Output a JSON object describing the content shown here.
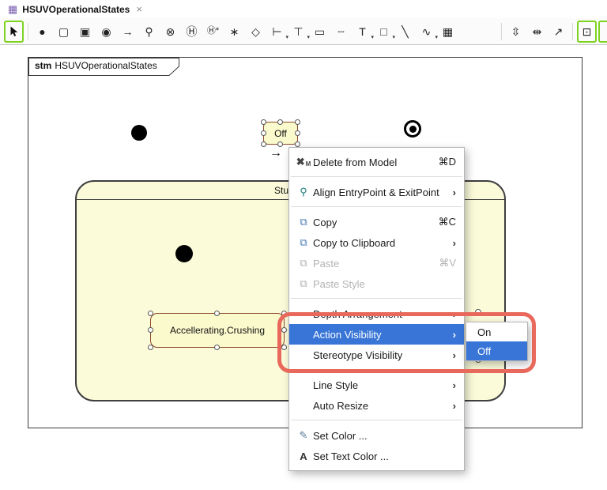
{
  "colors": {
    "selection_blue": "#3875D7",
    "annotation_red": "#E8695B",
    "state_fill": "#FBFACD",
    "state_border": "#8D4A2B",
    "tool_selected_green": "#7ED321"
  },
  "tab": {
    "icon_glyph": "▦",
    "label": "HSUVOperationalStates",
    "close": "×"
  },
  "toolbar": {
    "caret": "▾",
    "tools": [
      {
        "name": "pointer-tool",
        "glyph": ""
      },
      {
        "name": "initial-state-tool",
        "glyph": "●"
      },
      {
        "name": "state-tool",
        "glyph": "▢"
      },
      {
        "name": "submachine-state-tool",
        "glyph": "▣"
      },
      {
        "name": "final-state-tool",
        "glyph": "◉"
      },
      {
        "name": "transition-tool",
        "glyph": "→"
      },
      {
        "name": "entry-point-tool",
        "glyph": "⚲"
      },
      {
        "name": "exit-point-tool",
        "glyph": "⊗"
      },
      {
        "name": "shallow-history-tool",
        "glyph": "Ⓗ"
      },
      {
        "name": "deep-history-tool",
        "glyph": "Ⓗ*"
      },
      {
        "name": "junction-tool",
        "glyph": "∗"
      },
      {
        "name": "choice-tool",
        "glyph": "◇"
      },
      {
        "name": "fork-tool",
        "glyph": "⊢"
      },
      {
        "name": "join-tool",
        "glyph": "⊤"
      },
      {
        "name": "note-tool",
        "glyph": "▭"
      },
      {
        "name": "anchor-tool",
        "glyph": "┄"
      },
      {
        "name": "text-tool",
        "glyph": "T"
      },
      {
        "name": "rectangle-tool",
        "glyph": "□"
      },
      {
        "name": "line-tool",
        "glyph": "╲"
      },
      {
        "name": "curve-tool",
        "glyph": "∿"
      },
      {
        "name": "image-tool",
        "glyph": "▦"
      },
      {
        "name": "distribute-vertical-tool",
        "glyph": "⇳"
      },
      {
        "name": "center-horizontal-tool",
        "glyph": "⇹"
      },
      {
        "name": "pin-tool",
        "glyph": "↗"
      },
      {
        "name": "image-shape-tool",
        "glyph": "⊡"
      }
    ]
  },
  "diagram": {
    "frame_keyword": "stm",
    "frame_name": "HSUVOperationalStates",
    "off_state": "Off",
    "composite_state_visible": "Stu",
    "inner_state": "Accellerating.Crushing",
    "manipulator_arrow": "→"
  },
  "context_menu": {
    "arrow": "›",
    "items": [
      {
        "label": "Delete from Model",
        "shortcut": "⌘D",
        "icon": "✖",
        "icon_sub": "M"
      },
      {
        "label": "Align EntryPoint & ExitPoint",
        "icon": "⚲"
      },
      {
        "label": "Copy",
        "shortcut": "⌘C",
        "icon": "⧉"
      },
      {
        "label": "Copy to Clipboard",
        "icon": "⧉"
      },
      {
        "label": "Paste",
        "shortcut": "⌘V",
        "icon": "⧉"
      },
      {
        "label": "Paste Style",
        "icon": "⧉"
      },
      {
        "label": "Depth Arrangement"
      },
      {
        "label": "Action Visibility"
      },
      {
        "label": "Stereotype Visibility"
      },
      {
        "label": "Line Style"
      },
      {
        "label": "Auto Resize"
      },
      {
        "label": "Set Color ...",
        "icon": "✎"
      },
      {
        "label": "Set Text Color ...",
        "icon": "A"
      }
    ]
  },
  "submenu": {
    "items": [
      {
        "label": "On"
      },
      {
        "label": "Off"
      }
    ]
  }
}
